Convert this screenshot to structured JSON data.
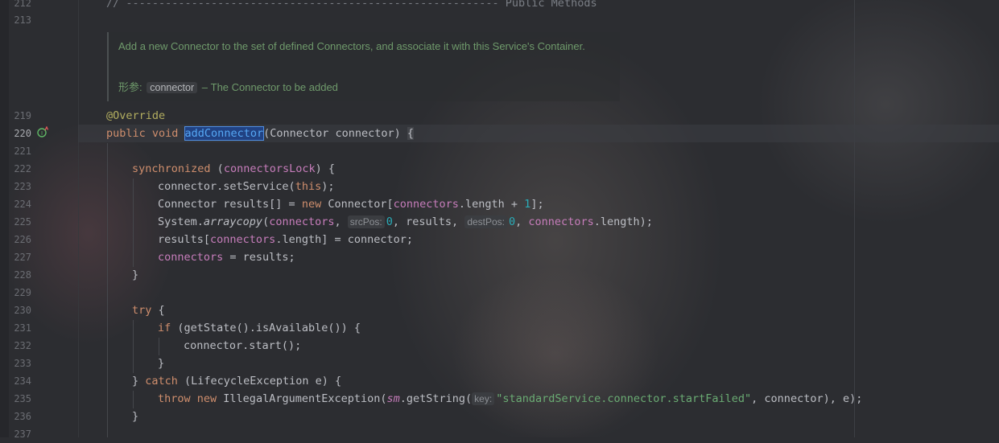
{
  "gutter": {
    "line_numbers": [
      "212",
      "213",
      "219",
      "220",
      "221",
      "222",
      "223",
      "224",
      "225",
      "226",
      "227",
      "228",
      "229",
      "230",
      "231",
      "232",
      "233",
      "234",
      "235",
      "236",
      "237"
    ]
  },
  "comment_header": "// --------------------------------------------------------- Public Methods",
  "javadoc": {
    "description": "Add a new Connector to the set of defined Connectors, and associate it with this Service's Container.",
    "param_tag": "形参:",
    "param_name": "connector",
    "param_desc": "– The Connector to be added"
  },
  "code": {
    "annotation": "@Override",
    "l220_kw": "public void ",
    "l220_method": "addConnector",
    "l220_rest": "(Connector connector) ",
    "l220_brace": "{",
    "l222_kw": "synchronized",
    "l222_a": " (",
    "l222_field": "connectorsLock",
    "l222_b": ") {",
    "l223_a": "connector.setService(",
    "l223_kw": "this",
    "l223_b": ");",
    "l224_a": "Connector results[] = ",
    "l224_kw": "new",
    "l224_b": " Connector[",
    "l224_field": "connectors",
    "l224_c": ".length + ",
    "l224_num": "1",
    "l224_d": "];",
    "l225_a": "System.",
    "l225_method": "arraycopy",
    "l225_b": "(",
    "l225_field1": "connectors",
    "l225_c": ", ",
    "l225_hint1": "srcPos:",
    "l225_num1": "0",
    "l225_d": ", results, ",
    "l225_hint2": "destPos:",
    "l225_num2": "0",
    "l225_e": ", ",
    "l225_field2": "connectors",
    "l225_f": ".length);",
    "l226_a": "results[",
    "l226_field": "connectors",
    "l226_b": ".length] = connector;",
    "l227_field": "connectors",
    "l227_a": " = results;",
    "l228": "}",
    "l230_kw": "try",
    "l230_a": " {",
    "l231_kw": "if",
    "l231_a": " (getState().isAvailable()) {",
    "l232": "connector.start();",
    "l233": "}",
    "l234_a": "} ",
    "l234_kw": "catch",
    "l234_b": " (LifecycleException e) {",
    "l235_kw1": "throw",
    "l235_kw2": "new",
    "l235_a": " IllegalArgumentException(",
    "l235_sm": "sm",
    "l235_b": ".getString(",
    "l235_hint": "key:",
    "l235_str": "\"standardService.connector.startFailed\"",
    "l235_c": ", connector), e);",
    "l236": "}"
  },
  "colors": {
    "background": "#2c2d31",
    "keyword": "#cf8e6d",
    "annotation": "#b3ae60",
    "field": "#c77dbb",
    "number": "#2aacb8",
    "string": "#6aab73",
    "doc_comment": "#6f9a6b",
    "selection": "#214283"
  },
  "icons": {
    "gutter_icon": "implements-override-icon"
  }
}
